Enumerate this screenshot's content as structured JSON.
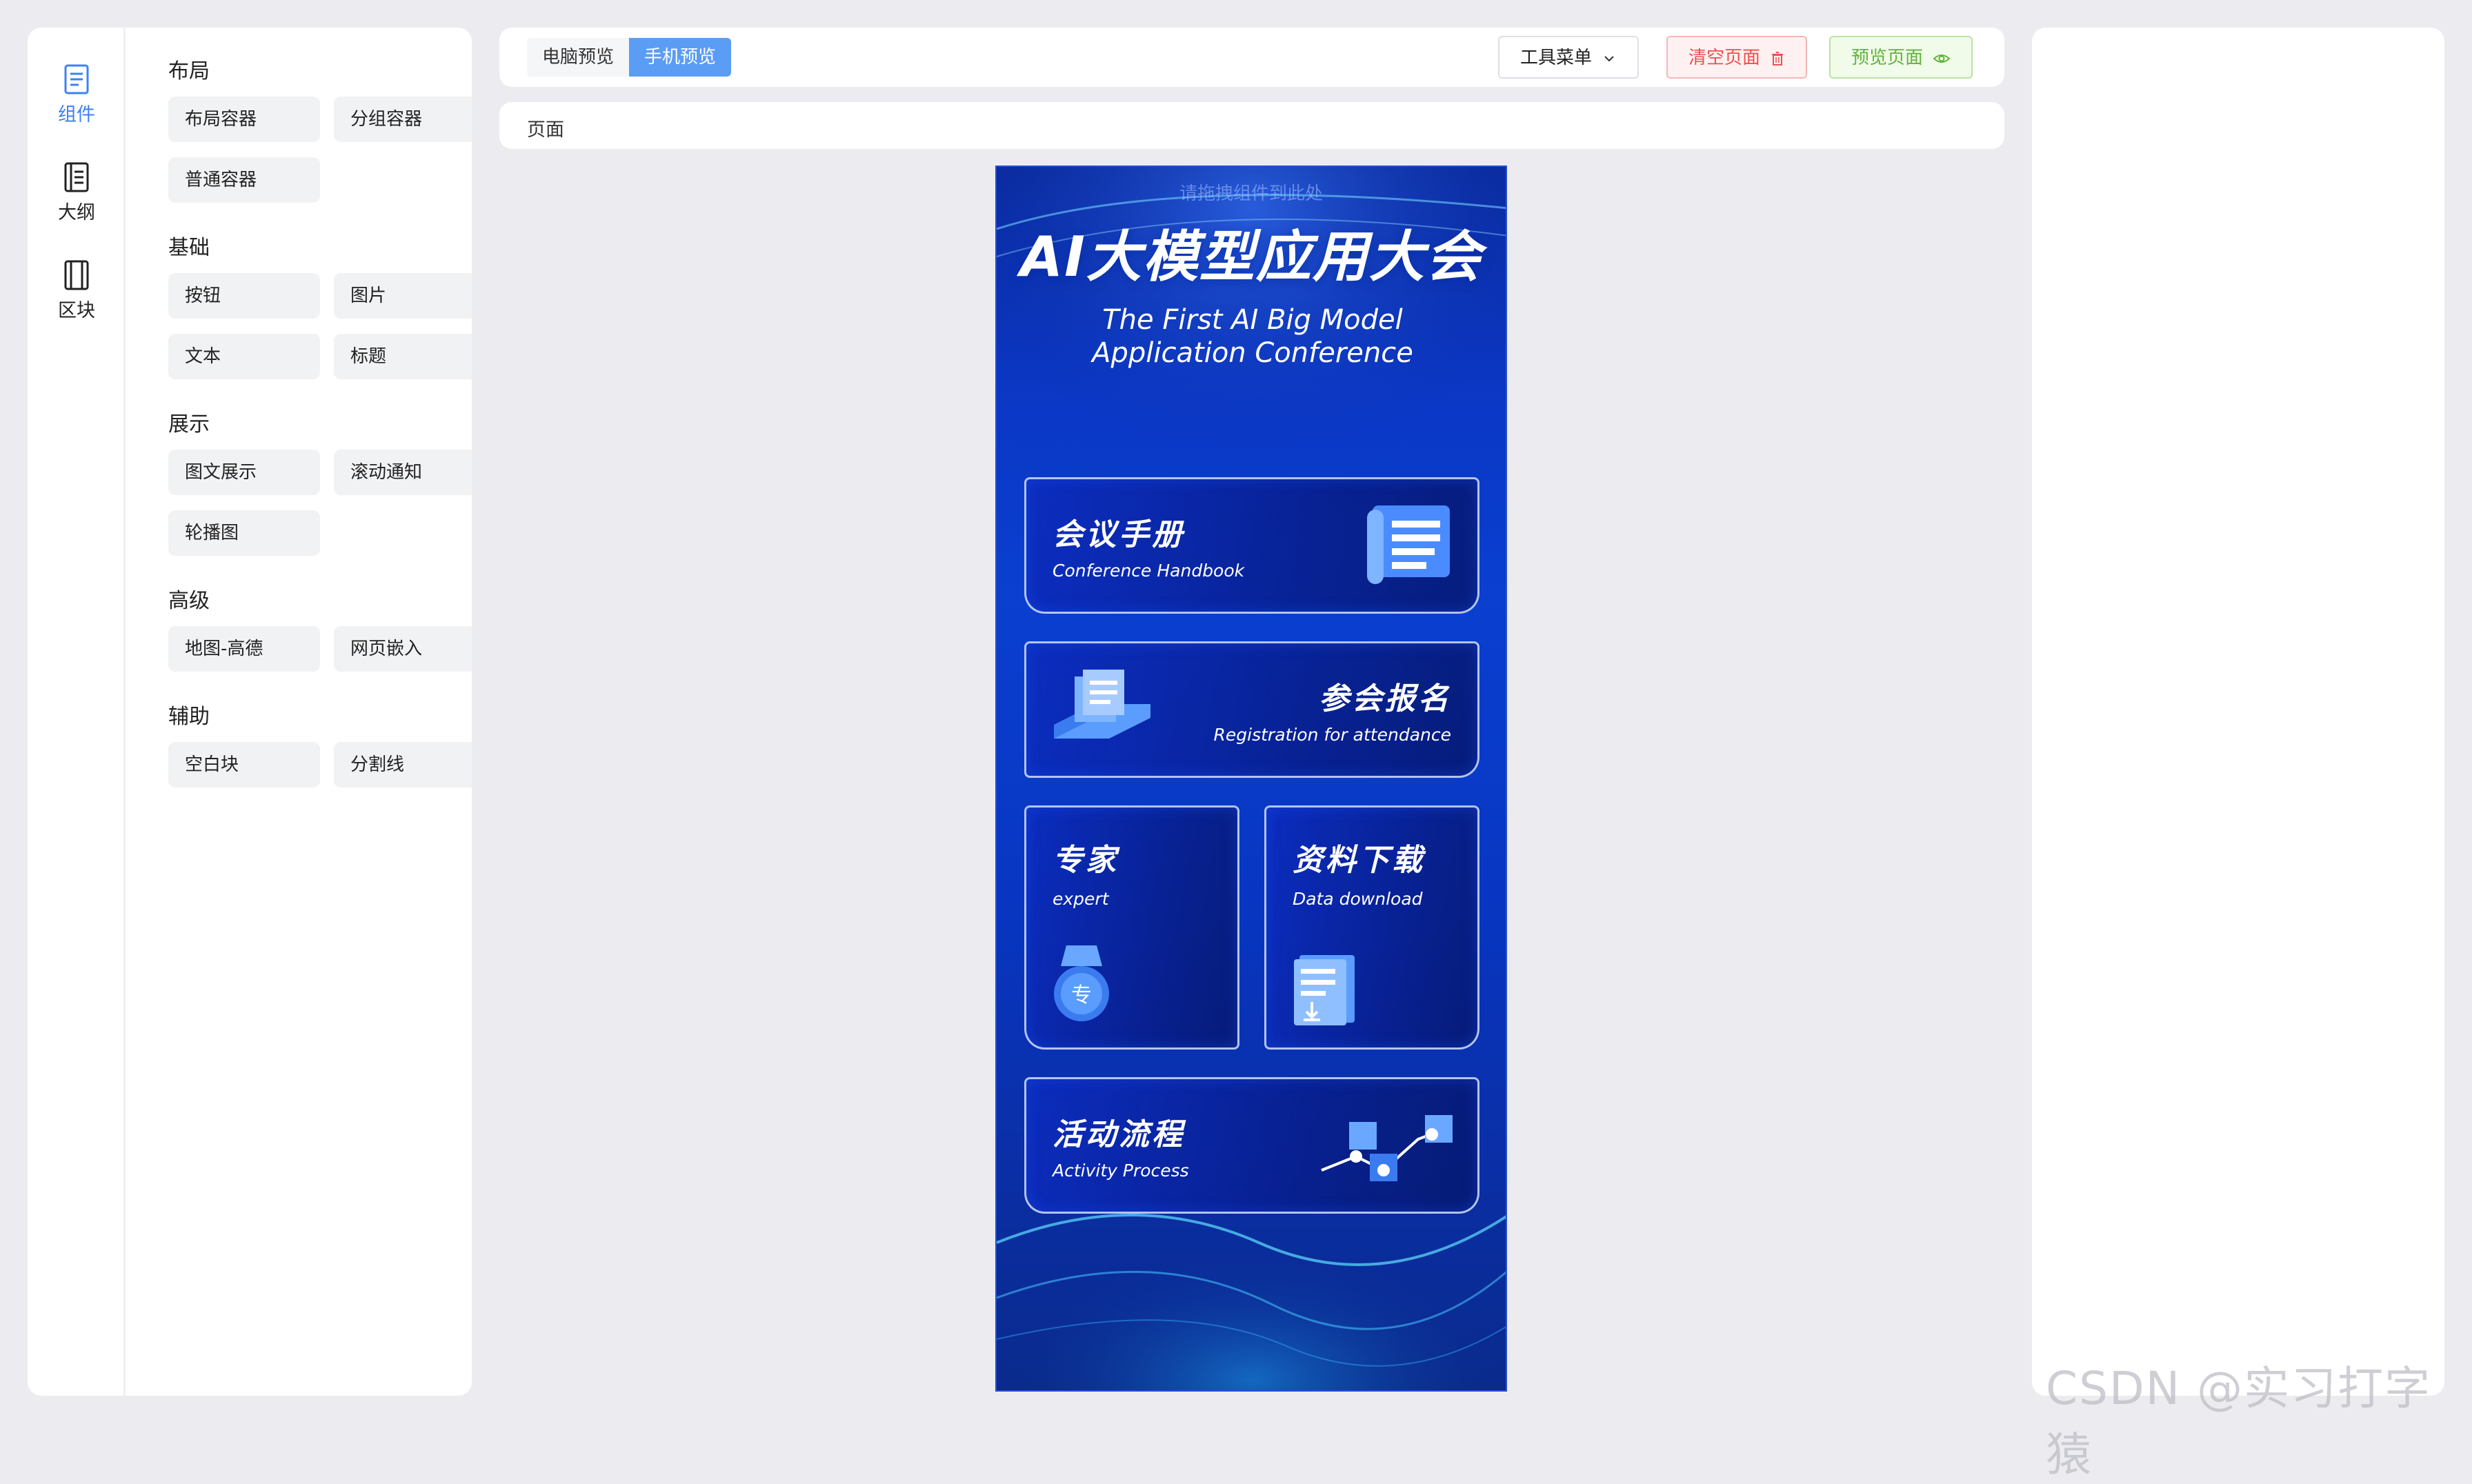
{
  "rail": {
    "components": "组件",
    "outline": "大纲",
    "blocks": "区块"
  },
  "palette": {
    "groups": [
      {
        "title": "布局",
        "items": [
          "布局容器",
          "分组容器",
          "普通容器"
        ]
      },
      {
        "title": "基础",
        "items": [
          "按钮",
          "图片",
          "文本",
          "标题"
        ]
      },
      {
        "title": "展示",
        "items": [
          "图文展示",
          "滚动通知",
          "轮播图"
        ]
      },
      {
        "title": "高级",
        "items": [
          "地图-高德",
          "网页嵌入"
        ]
      },
      {
        "title": "辅助",
        "items": [
          "空白块",
          "分割线"
        ]
      }
    ]
  },
  "toolbar": {
    "tab_desktop": "电脑预览",
    "tab_mobile": "手机预览",
    "tools_menu": "工具菜单",
    "clear_page": "清空页面",
    "preview_page": "预览页面"
  },
  "breadcrumb": {
    "label": "页面"
  },
  "canvas": {
    "drop_hint": "请拖拽组件到此处",
    "title": "AI大模型应用大会",
    "subtitle": "The First AI Big Model Application Conference",
    "cards": [
      {
        "title": "会议手册",
        "subtitle": "Conference Handbook",
        "icon": "scroll-document-icon"
      },
      {
        "title": "参会报名",
        "subtitle": "Registration for attendance",
        "icon": "file-stack-icon"
      },
      {
        "title": "专家",
        "subtitle": "expert",
        "icon": "medal-icon",
        "badge": "专"
      },
      {
        "title": "资料下载",
        "subtitle": "Data download",
        "icon": "download-document-icon"
      },
      {
        "title": "活动流程",
        "subtitle": "Activity Process",
        "icon": "flow-cubes-icon"
      }
    ]
  },
  "watermark": "CSDN @实习打字猿",
  "colors": {
    "accent": "#3b82f6",
    "active_tab": "#5b9cf5",
    "danger": "#ef4e4e",
    "success": "#60b33c",
    "canvas_blue": "#0a3fd0"
  }
}
